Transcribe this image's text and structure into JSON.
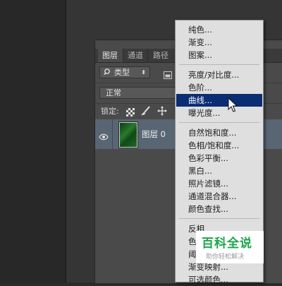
{
  "layers_panel": {
    "tabs": [
      {
        "label": "图层",
        "active": true
      },
      {
        "label": "通道",
        "active": false
      },
      {
        "label": "路径",
        "active": false
      }
    ],
    "filter": {
      "label": "类型",
      "icon": "search-icon"
    },
    "blend_mode": "正常",
    "lock_label": "锁定:",
    "layer": {
      "name": "图层 0",
      "visible": true,
      "thumbnail": "green-plant-image"
    }
  },
  "adjustment_menu": {
    "groups": [
      [
        "纯色...",
        "渐变...",
        "图案..."
      ],
      [
        "亮度/对比度...",
        "色阶...",
        "曲线...",
        "曝光度..."
      ],
      [
        "自然饱和度...",
        "色相/饱和度...",
        "色彩平衡...",
        "黑白...",
        "照片滤镜...",
        "通道混合器...",
        "颜色查找..."
      ],
      [
        "反相",
        "色",
        "阈",
        "渐变映射...",
        "可选颜色..."
      ]
    ],
    "highlighted": "曲线...",
    "highlight_color": "#0a2d73"
  },
  "watermark": {
    "title": "百科全说",
    "subtitle": "助你轻松解决",
    "color": "#1aa64a"
  }
}
